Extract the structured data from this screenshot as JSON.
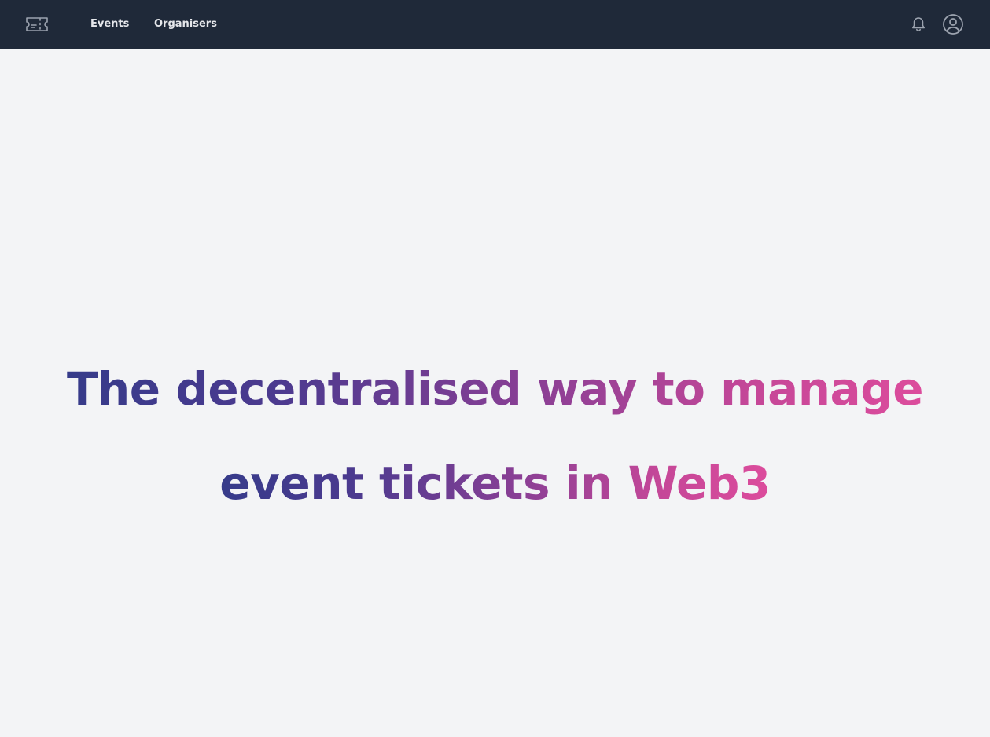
{
  "header": {
    "logo_icon": "ticket-icon",
    "nav": [
      {
        "label": "Events"
      },
      {
        "label": "Organisers"
      }
    ],
    "notification_icon": "bell-icon",
    "account_icon": "user-circle-icon"
  },
  "hero": {
    "title": "The decentralised way to manage event tickets in Web3",
    "gradient_start": "#363b8a",
    "gradient_end": "#dc4c9c"
  },
  "colors": {
    "navbar_bg": "#1f2939",
    "page_bg": "#f3f4f6",
    "nav_text": "#e5e7eb"
  }
}
